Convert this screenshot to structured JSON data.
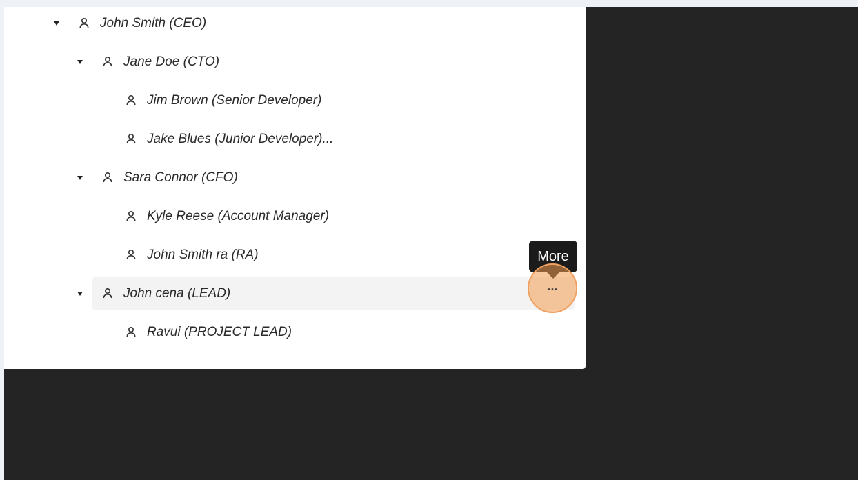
{
  "tree": [
    {
      "label": "John Smith (CEO)",
      "expanded": true
    },
    {
      "label": "Jane Doe (CTO)",
      "expanded": true
    },
    {
      "label": "Jim Brown (Senior Developer)",
      "expanded": null
    },
    {
      "label": "Jake Blues (Junior Developer)...",
      "expanded": null
    },
    {
      "label": "Sara Connor (CFO)",
      "expanded": true
    },
    {
      "label": "Kyle Reese (Account Manager)",
      "expanded": null
    },
    {
      "label": "John Smith ra (RA)",
      "expanded": null
    },
    {
      "label": "John cena (LEAD)",
      "expanded": true,
      "hovered": true
    },
    {
      "label": "Ravui (PROJECT LEAD)",
      "expanded": null
    }
  ],
  "more_button": {
    "icon": "ellipsis-icon",
    "glyph": "...",
    "tooltip": "More"
  },
  "colors": {
    "highlight": "#f29c50",
    "background": "#242424",
    "panel": "#ffffff"
  }
}
